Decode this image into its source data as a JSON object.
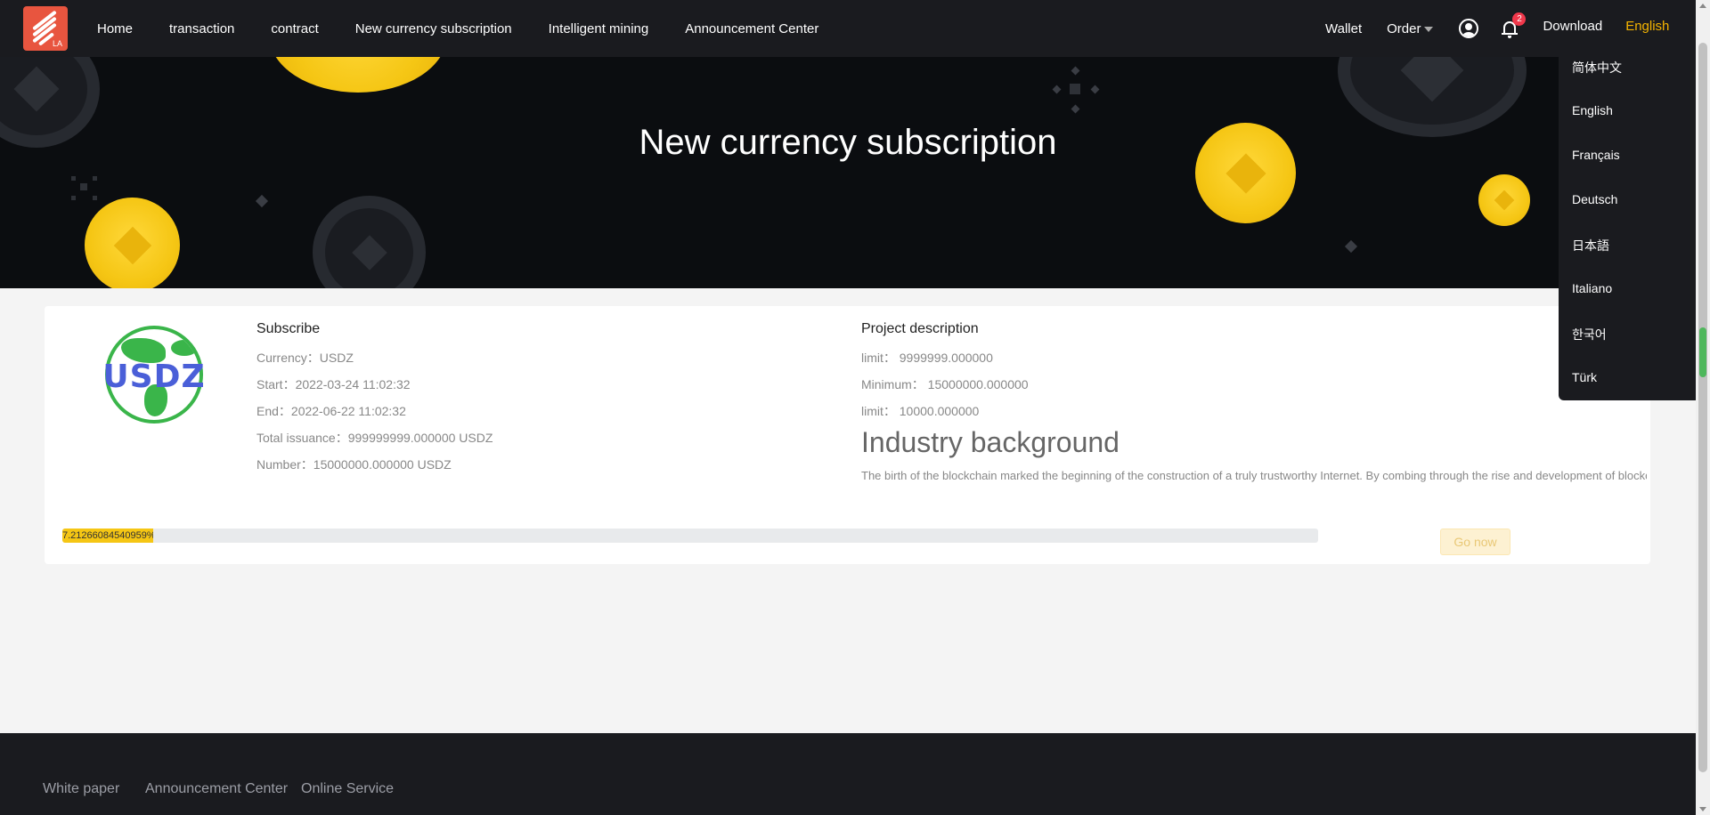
{
  "logo": {
    "text": "LA",
    "color": "#e8553f"
  },
  "nav": {
    "items": [
      "Home",
      "transaction",
      "contract",
      "New currency subscription",
      "Intelligent mining",
      "Announcement Center"
    ],
    "wallet": "Wallet",
    "order": "Order",
    "notification_count": "2",
    "download": "Download",
    "language": "English"
  },
  "hero": {
    "title": "New currency subscription"
  },
  "project": {
    "logo_text": "USDZ",
    "subscribe": {
      "title": "Subscribe",
      "currency": "Currency：USDZ",
      "start": "Start：2022-03-24 11:02:32",
      "end": "End：2022-06-22 11:02:32",
      "total_issuance": "Total issuance：999999999.000000 USDZ",
      "number": "Number：15000000.000000 USDZ"
    },
    "description": {
      "title": "Project description",
      "limit": "limit： 9999999.000000",
      "minimum": "Minimum： 15000000.000000",
      "limit2": "limit： 10000.000000"
    },
    "industry": {
      "title": "Industry background",
      "text": "The birth of the blockchain marked the beginning of the construction of a truly trustworthy Internet. By combing through the rise and development of blockchain technology"
    },
    "progress": {
      "percent": 7.21266084540959,
      "label": "7.21266084540959%"
    },
    "go_button": "Go now"
  },
  "footer": {
    "links": [
      "White paper",
      "Announcement Center",
      "Online Service"
    ]
  },
  "language_menu": {
    "options": [
      "简体中文",
      "English",
      "Français",
      "Deutsch",
      "日本語",
      "Italiano",
      "한국어",
      "Türk"
    ]
  },
  "colors": {
    "accent": "#f5b400",
    "coin": "#f5c614",
    "nav_bg": "#1a1b1f",
    "badge": "#f0384b"
  }
}
